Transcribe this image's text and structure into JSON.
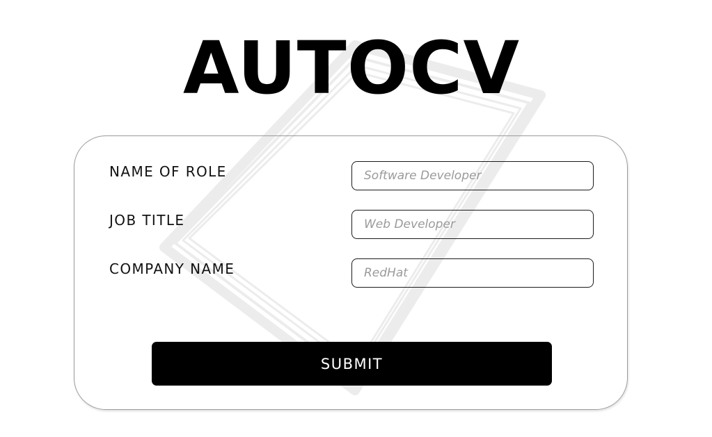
{
  "app": {
    "title": "AUTOCV"
  },
  "form": {
    "fields": [
      {
        "label": "NAME OF ROLE",
        "placeholder": "Software Developer",
        "value": ""
      },
      {
        "label": "JOB TITLE",
        "placeholder": "Web Developer",
        "value": ""
      },
      {
        "label": "COMPANY NAME",
        "placeholder": "RedHat",
        "value": ""
      }
    ],
    "submit_label": "SUBMIT"
  },
  "colors": {
    "background": "#ffffff",
    "text": "#000000",
    "button_background": "#000000",
    "button_text": "#ffffff",
    "card_border": "#9a9a9a",
    "watermark": "#eeeeee"
  }
}
